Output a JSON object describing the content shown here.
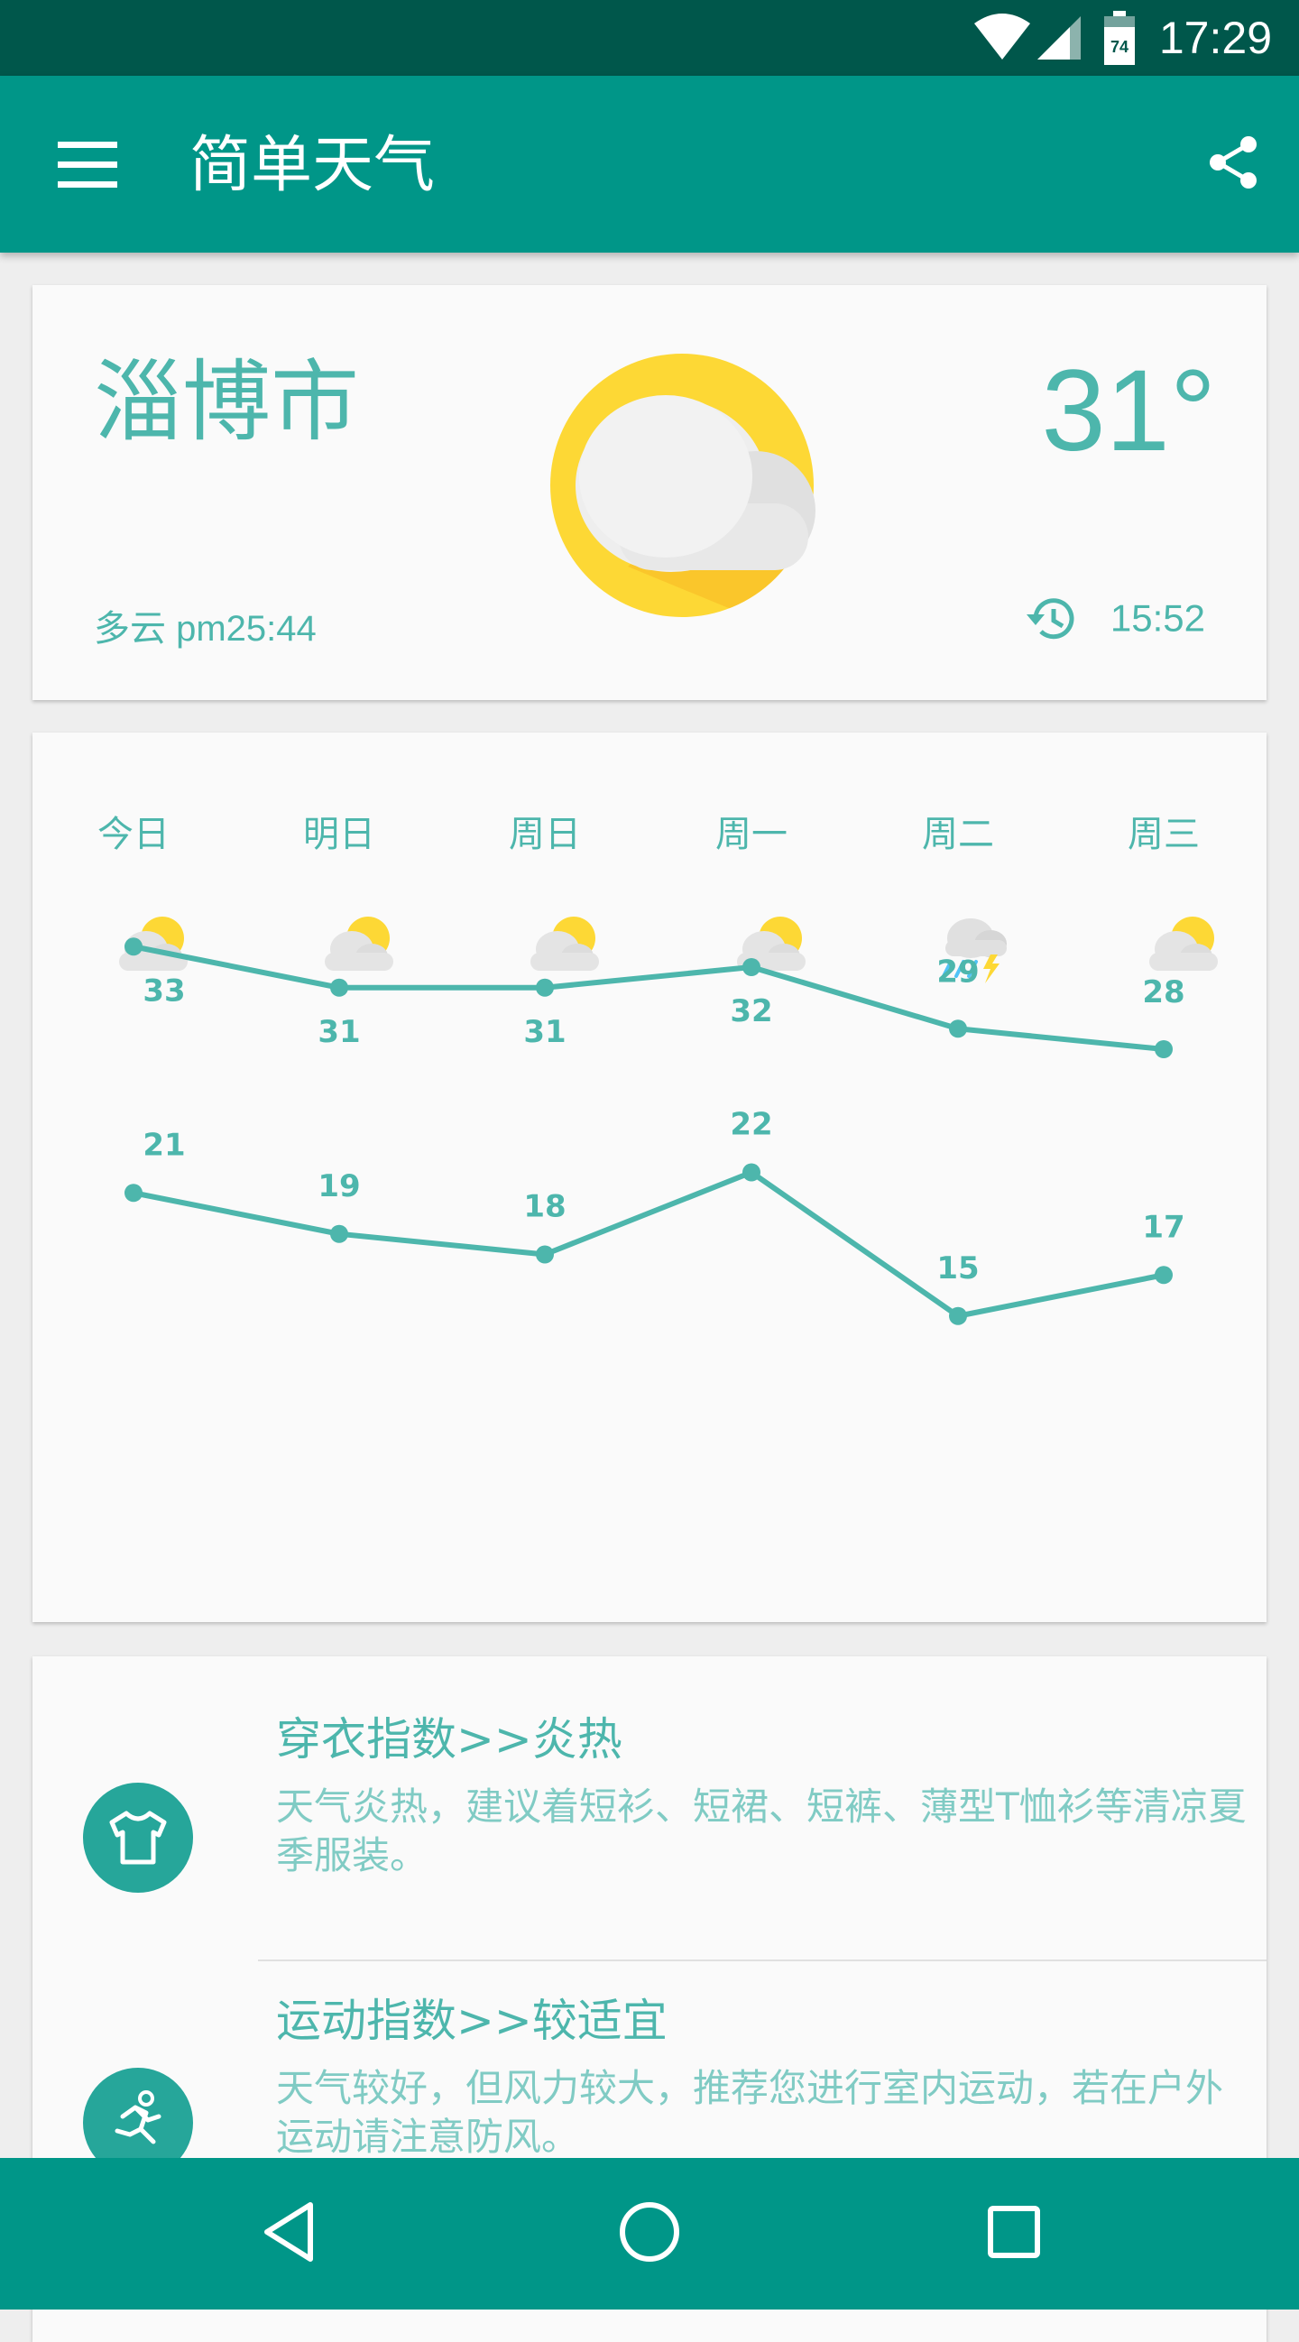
{
  "status_bar": {
    "time": "17:29",
    "battery_level": "74"
  },
  "app_bar": {
    "title": "简单天气",
    "menu_icon": "menu-icon",
    "share_icon": "share-icon"
  },
  "current": {
    "city": "淄博市",
    "temperature": "31°",
    "description": "多云  pm25:44",
    "update_time": "15:52",
    "icon": "partly-cloudy-icon"
  },
  "forecast": {
    "days": [
      {
        "label": "今日",
        "icon": "partly-cloudy-icon"
      },
      {
        "label": "明日",
        "icon": "partly-cloudy-icon"
      },
      {
        "label": "周日",
        "icon": "partly-cloudy-icon"
      },
      {
        "label": "周一",
        "icon": "partly-cloudy-icon"
      },
      {
        "label": "周二",
        "icon": "thunder-rain-icon"
      },
      {
        "label": "周三",
        "icon": "partly-cloudy-icon"
      }
    ]
  },
  "chart_data": {
    "type": "line",
    "categories": [
      "今日",
      "明日",
      "周日",
      "周一",
      "周二",
      "周三"
    ],
    "series": [
      {
        "values": [
          33,
          31,
          31,
          32,
          29,
          28
        ],
        "label_position": "below-first-then-alternating"
      },
      {
        "values": [
          21,
          19,
          18,
          22,
          15,
          17
        ],
        "label_position": "above"
      }
    ],
    "line_color": "#4db6ac",
    "grid": false
  },
  "indices": [
    {
      "title": "穿衣指数>>炎热",
      "body": "天气炎热，建议着短衫、短裙、短裤、薄型T恤衫等清凉夏季服装。",
      "icon": "tshirt-icon"
    },
    {
      "title": "运动指数>>较适宜",
      "body": "天气较好，但风力较大，推荐您进行室内运动，若在户外运动请注意防风。",
      "icon": "running-icon"
    }
  ],
  "nav_bar": {
    "back_icon": "back-icon",
    "home_icon": "home-icon",
    "recents_icon": "recents-icon"
  },
  "colors": {
    "primary": "#009688",
    "primary_dark": "#00574b",
    "accent_text": "#4db6ac",
    "sun": "#fdd835"
  }
}
